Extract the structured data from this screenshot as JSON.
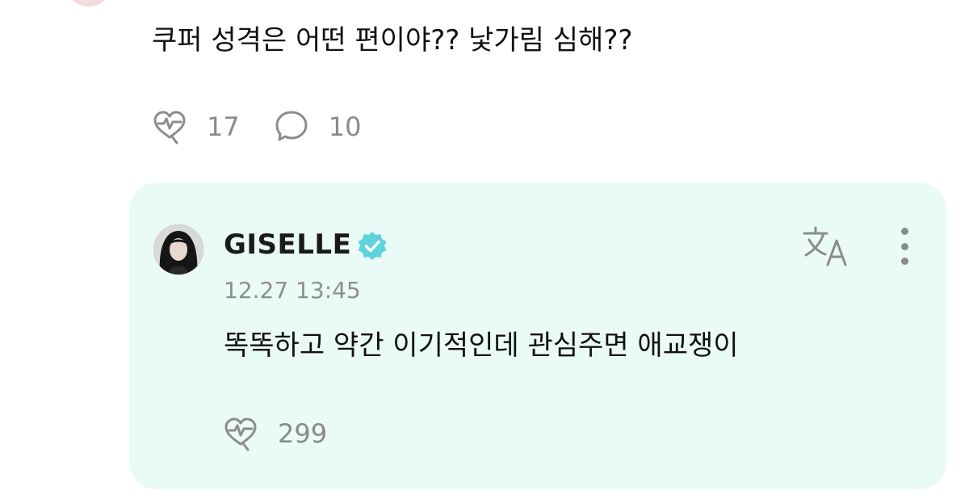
{
  "post": {
    "text": "쿠퍼 성격은 어떤 편이야?? 낯가림 심해??",
    "like_icon": "heart-pulse-icon",
    "like_count": "17",
    "comment_icon": "speech-bubble-icon",
    "comment_count": "10"
  },
  "reply": {
    "author": "GISELLE",
    "verified": true,
    "verified_icon": "verified-badge-icon",
    "timestamp": "12.27 13:45",
    "text": "똑똑하고 약간 이기적인데 관심주면 애교쟁이",
    "translate_icon": "translate-icon",
    "more_icon": "more-vertical-icon",
    "like_icon": "heart-pulse-icon",
    "like_count": "299"
  },
  "colors": {
    "card_background": "#eafaf7",
    "verified": "#5fd3dd",
    "muted_text": "#8e8e8e",
    "icon": "#8c8c8c"
  }
}
